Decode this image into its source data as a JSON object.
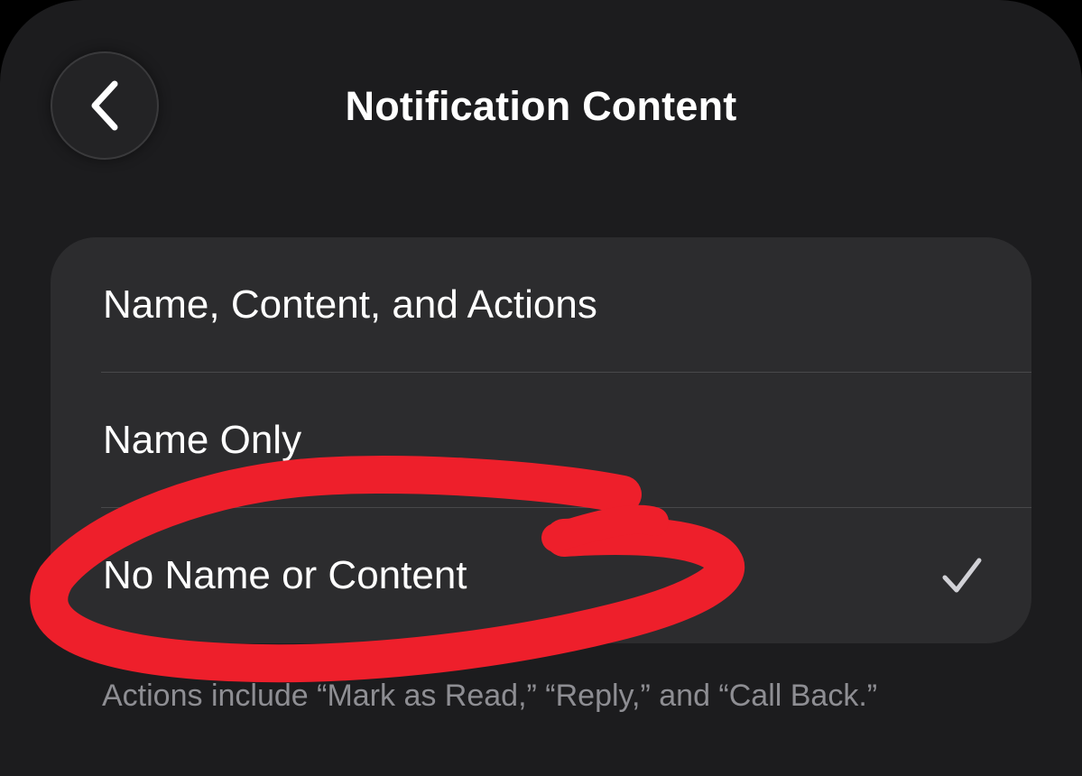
{
  "header": {
    "back_icon": "chevron-left-icon",
    "title": "Notification Content"
  },
  "options": [
    {
      "label": "Name, Content, and Actions",
      "selected": false
    },
    {
      "label": "Name Only",
      "selected": false
    },
    {
      "label": "No Name or Content",
      "selected": true
    }
  ],
  "checkmark_icon": "checkmark-icon",
  "footer": {
    "note": "Actions include “Mark as Read,” “Reply,” and “Call Back.”"
  },
  "annotation": {
    "shape": "hand-drawn-circle",
    "color": "#ee1f2b",
    "target": "No Name or Content"
  },
  "colors": {
    "background": "#1c1c1e",
    "group_background": "#2c2c2e",
    "text": "#ffffff",
    "secondary_text": "#8e8e93"
  }
}
